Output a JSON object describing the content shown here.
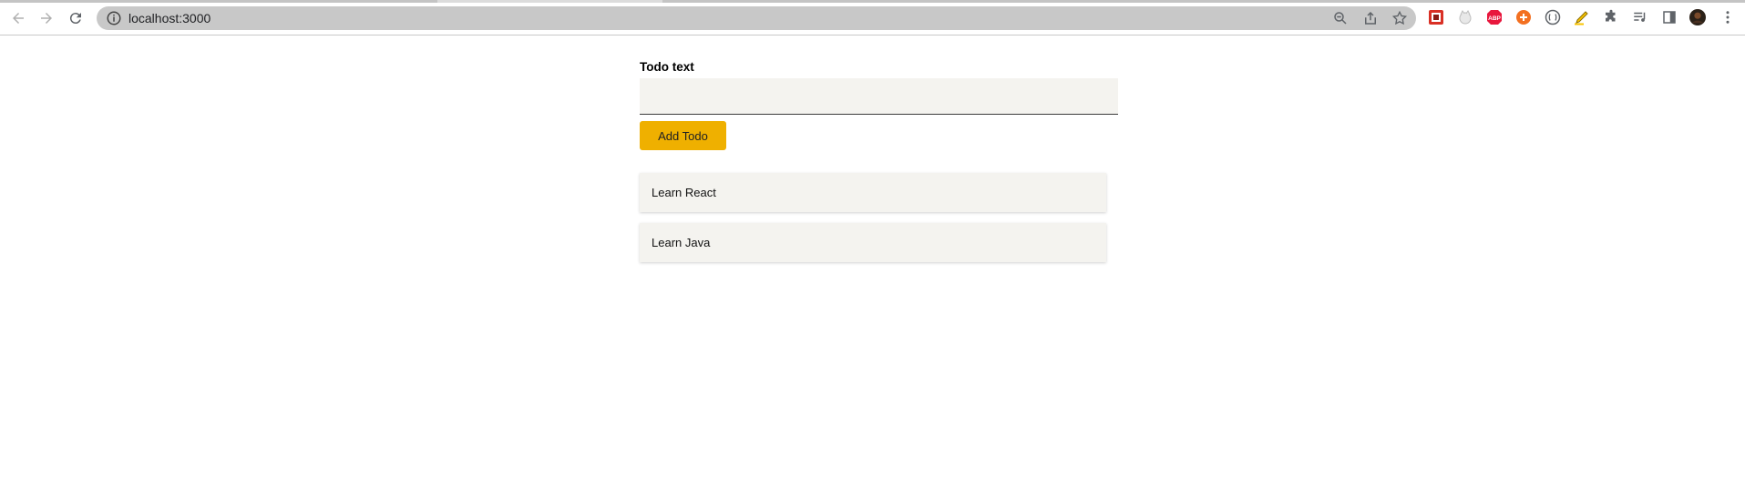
{
  "browser": {
    "url": "localhost:3000",
    "back_icon": "arrow-left-icon",
    "forward_icon": "arrow-right-icon",
    "reload_icon": "reload-icon",
    "extensions": [
      "extension-red-icon",
      "extension-cat-icon",
      "adblock-plus-icon",
      "extension-orange-icon",
      "extension-circle-icon",
      "extension-highlighter-icon",
      "extensions-puzzle-icon",
      "media-control-icon",
      "side-panel-icon",
      "profile-avatar",
      "menu-kebab-icon"
    ],
    "adblock_label": "ABP"
  },
  "form": {
    "label": "Todo text",
    "input_value": "",
    "input_placeholder": "",
    "button_label": "Add Todo"
  },
  "todos": {
    "items": [
      {
        "text": "Learn React"
      },
      {
        "text": "Learn Java"
      }
    ]
  },
  "colors": {
    "accent": "#efb000",
    "surface": "#f4f3ef",
    "omnibox": "#c8c8c8"
  }
}
